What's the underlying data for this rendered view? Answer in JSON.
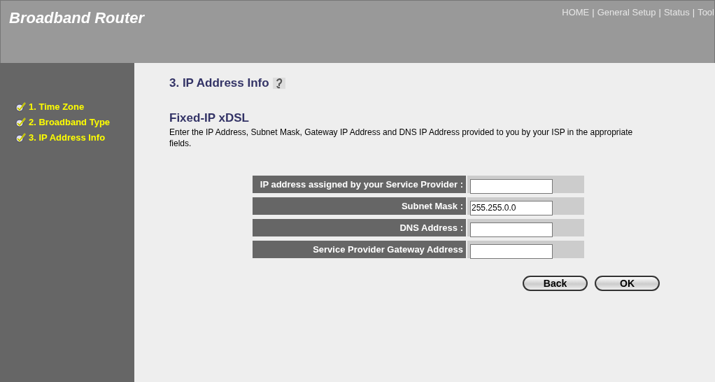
{
  "header": {
    "title": "Broadband Router",
    "nav_separator": "|",
    "nav": [
      {
        "label": "HOME"
      },
      {
        "label": "General Setup"
      },
      {
        "label": "Status"
      },
      {
        "label": "Tool"
      }
    ]
  },
  "sidebar": {
    "items": [
      {
        "label": "1. Time Zone",
        "checked": true
      },
      {
        "label": "2. Broadband Type",
        "checked": true
      },
      {
        "label": "3. IP Address Info",
        "checked": true
      }
    ]
  },
  "page": {
    "title": "3. IP Address Info",
    "section": "Fixed-IP xDSL",
    "description": "Enter the IP Address, Subnet Mask, Gateway IP Address and DNS IP Address provided to you by your ISP in the appropriate fields."
  },
  "form": [
    {
      "label": "IP address assigned by your Service Provider :"
    },
    {
      "label": "Subnet Mask :",
      "value": "255.255.0.0"
    },
    {
      "label": "DNS Address :"
    },
    {
      "label": "Service Provider Gateway Address"
    }
  ],
  "buttons": [
    "Back",
    "OK"
  ]
}
